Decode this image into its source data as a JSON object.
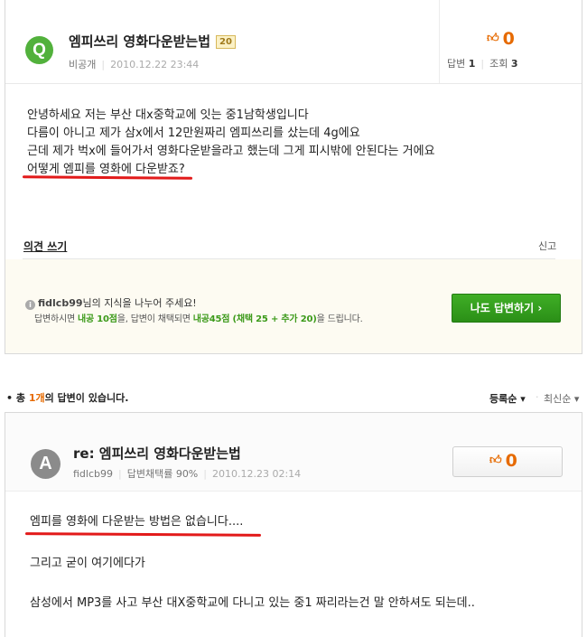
{
  "question": {
    "badge": "Q",
    "title": "엠피쓰리 영화다운받는법",
    "points": "20",
    "visibility": "비공개",
    "date": "2010.12.22 23:44",
    "likes": "0",
    "answers_label": "답변",
    "answers_count": "1",
    "views_label": "조회",
    "views_count": "3",
    "body_lines": [
      "안녕하세요 저는 부산 대x중학교에 잇는 중1남학생입니다",
      "다름이 아니고 제가 삼x에서 12만원짜리 엠피쓰리를 샀는데 4g에요",
      "근데 제가 벅x에 들어가서 영화다운받을라고 했는데 그게 피시밖에 안된다는 거에요",
      "어떻게 엠피를 영화에 다운받죠?"
    ],
    "opinion_link": "의견 쓰기",
    "report_link": "신고"
  },
  "share": {
    "username": "fidlcb99",
    "line1_suffix": "님의 지식을 나누어 주세요!",
    "line2_a": "답변하시면 ",
    "line2_b": "내공 10점",
    "line2_c": "을, 답변이 채택되면 ",
    "line2_d": "내공45점 (채택 25 + 추가 20)",
    "line2_e": "을 드립니다.",
    "button_label": "나도 답변하기 ›"
  },
  "answers_bar": {
    "prefix": "• 총 ",
    "count": "1개",
    "suffix": "의 답변이 있습니다.",
    "sort_active": "등록순 ▾",
    "sort_other": "최신순 ▾"
  },
  "answer": {
    "badge": "A",
    "title": "re: 엠피쓰리 영화다운받는법",
    "author": "fidlcb99",
    "adoption": "답변채택률 90%",
    "date": "2010.12.23 02:14",
    "likes": "0",
    "body_1": "엠피를 영화에 다운받는 방법은 없습니다....",
    "body_2": "그리고 굳이 여기에다가",
    "body_3": "삼성에서 MP3를 사고 부산 대X중학교에 다니고 있는 중1 짜리라는건 말 안하셔도 되는데.."
  },
  "colors": {
    "question_badge": "#52b13c",
    "answer_badge": "#8b8b8b",
    "accent_orange": "#e66a00",
    "answer_button": "#2b8f17",
    "underline_red": "#e21a1a"
  },
  "icons": [
    "thumbs-up-icon",
    "info-icon",
    "chevron-down-icon"
  ]
}
